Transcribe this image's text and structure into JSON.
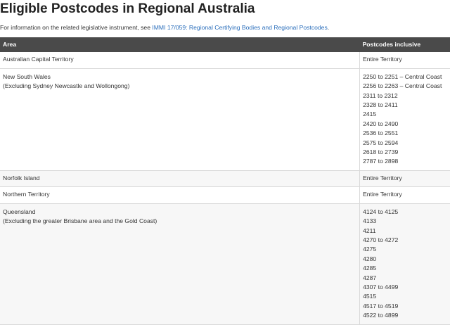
{
  "title": "Eligible Postcodes in Regional Australia",
  "intro": {
    "prefix": "For information on the related legislative instrument, see ",
    "link_text": "IMMI 17/059: Regional Certifying Bodies and Regional Postcodes",
    "suffix": "."
  },
  "table": {
    "headers": [
      "Area",
      "Postcodes inclusive"
    ],
    "rows": [
      {
        "area": "Australian Capital Territory",
        "note": "",
        "postcodes": [
          "Entire Territory"
        ]
      },
      {
        "area": "New South Wales",
        "note": "(Excluding Sydney Newcastle and Wollongong)",
        "postcodes": [
          "2250 to 2251 – Central Coast",
          "2256 to 2263 – Central Coast",
          "2311 to 2312",
          "2328 to 2411",
          "2415",
          "2420 to 2490",
          "2536 to 2551",
          "2575 to 2594",
          "2618 to 2739",
          "2787 to 2898"
        ]
      },
      {
        "area": "Norfolk Island",
        "note": "",
        "postcodes": [
          "Entire Territory"
        ]
      },
      {
        "area": "Northern Territory",
        "note": "",
        "postcodes": [
          "Entire Territory"
        ]
      },
      {
        "area": "Queensland",
        "note": "(Excluding the greater Brisbane area and the Gold Coast)",
        "postcodes": [
          "4124 to 4125",
          "4133",
          "4211",
          "4270 to 4272",
          "4275",
          "4280",
          "4285",
          "4287",
          "4307 to 4499",
          "4515",
          "4517 to 4519",
          "4522 to 4899"
        ]
      }
    ]
  }
}
